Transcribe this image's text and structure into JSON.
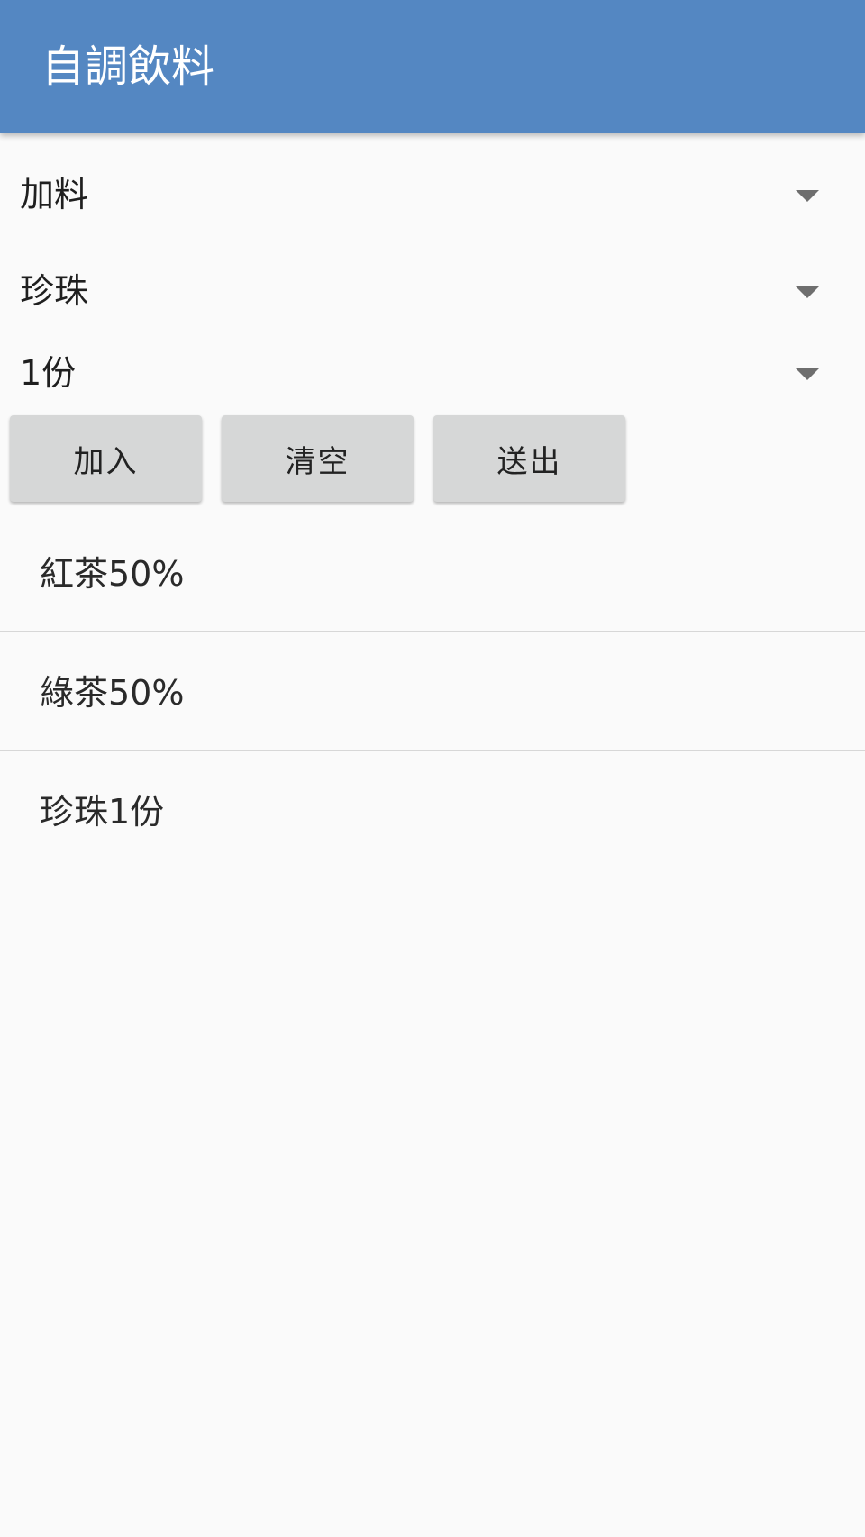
{
  "app_bar": {
    "title": "自調飲料"
  },
  "spinners": [
    {
      "value": "加料"
    },
    {
      "value": "珍珠"
    },
    {
      "value": "1份"
    }
  ],
  "buttons": {
    "add": "加入",
    "clear": "清空",
    "send": "送出"
  },
  "order_list": {
    "items": [
      {
        "label": "紅茶50%"
      },
      {
        "label": "綠茶50%"
      },
      {
        "label": "珍珠1份"
      }
    ]
  },
  "colors": {
    "app_bar": "#5487c2",
    "background": "#fafafa",
    "button": "#d6d7d7",
    "divider": "#d7d7d7"
  },
  "icons": {
    "dropdown": "dropdown-arrow-icon"
  }
}
